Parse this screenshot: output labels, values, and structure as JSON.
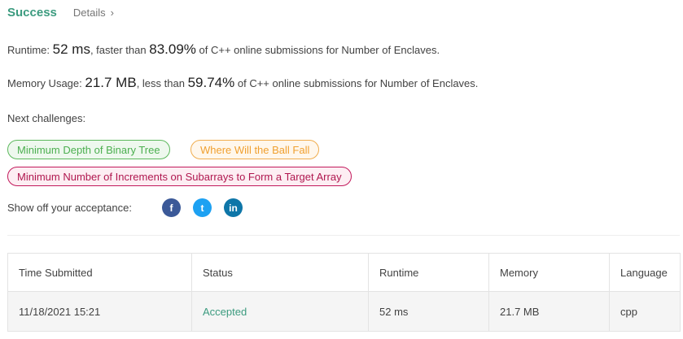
{
  "header": {
    "status": "Success",
    "details_label": "Details",
    "chevron": "›"
  },
  "runtime": {
    "label": "Runtime:",
    "value": "52 ms",
    "comparison_prefix": ", faster than",
    "percent": "83.09%",
    "suffix": "of C++ online submissions for Number of Enclaves."
  },
  "memory": {
    "label": "Memory Usage:",
    "value": "21.7 MB",
    "comparison_prefix": ", less than",
    "percent": "59.74%",
    "suffix": "of C++ online submissions for Number of Enclaves."
  },
  "next_challenges": {
    "label": "Next challenges:",
    "items": [
      {
        "label": "Minimum Depth of Binary Tree",
        "difficulty_color": "#5cb85c"
      },
      {
        "label": "Where Will the Ball Fall",
        "difficulty_color": "#f0ad4e"
      },
      {
        "label": "Minimum Number of Increments on Subarrays to Form a Target Array",
        "difficulty_color": "#c2185b"
      }
    ]
  },
  "share": {
    "label": "Show off your acceptance:",
    "icons": [
      {
        "name": "facebook-icon",
        "glyph": "f",
        "color": "#3b5998"
      },
      {
        "name": "twitter-icon",
        "glyph": "t",
        "color": "#1da1f2"
      },
      {
        "name": "linkedin-icon",
        "glyph": "in",
        "color": "#0e76a8"
      }
    ]
  },
  "table": {
    "headers": [
      "Time Submitted",
      "Status",
      "Runtime",
      "Memory",
      "Language"
    ],
    "rows": [
      [
        "11/18/2021 15:21",
        "Accepted",
        "52 ms",
        "21.7 MB",
        "cpp"
      ]
    ]
  },
  "colors": {
    "accent": "#3c9b7f"
  }
}
